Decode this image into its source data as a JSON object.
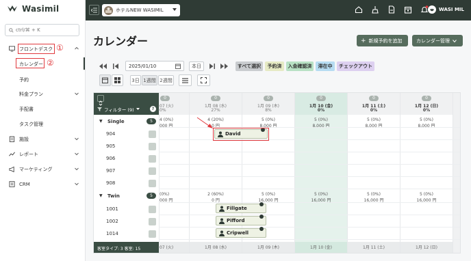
{
  "app": {
    "name": "Wasimil"
  },
  "search": {
    "placeholder": "ctrl/⌘ + K"
  },
  "sidebar": {
    "items": [
      {
        "label": "フロントデスク",
        "icon": "monitor-icon"
      },
      {
        "label": "カレンダー"
      },
      {
        "label": "予約"
      },
      {
        "label": "料金プラン"
      },
      {
        "label": "手配書"
      },
      {
        "label": "タスク管理"
      },
      {
        "label": "施設",
        "icon": "building-icon"
      },
      {
        "label": "レポート",
        "icon": "report-icon"
      },
      {
        "label": "マーケティング",
        "icon": "megaphone-icon"
      },
      {
        "label": "CRM",
        "icon": "crm-icon"
      }
    ],
    "annotations": {
      "one": "①",
      "two": "②"
    }
  },
  "topbar": {
    "hotel": "ホテルNEW WASIMIL",
    "user": "WASI MIL",
    "icons": [
      "home-icon",
      "cleaning-icon",
      "document-icon",
      "calendar-icon",
      "bell-icon"
    ]
  },
  "page": {
    "title": "カレンダー",
    "add_button": "新規予約を追加",
    "manage_button": "カレンダー管理"
  },
  "toolbar": {
    "date": "2025/01/10",
    "today": "本日",
    "select_all": "すべて選択",
    "status": [
      "予約済",
      "入金確認済",
      "滞在中",
      "チェックアウト"
    ],
    "spans": [
      "3日",
      "1週間",
      "2週間"
    ],
    "status_colors": [
      "#e6eac4",
      "#b8e1c4",
      "#b6dcf2",
      "#ddd0f0"
    ]
  },
  "calendar": {
    "filter_label": "フィルター (9)",
    "days": [
      {
        "label": "1月 07 (火)",
        "count": "0",
        "pct": "0%",
        "today": false
      },
      {
        "label": "1月 08 (水)",
        "count": "0",
        "pct": "27%",
        "today": false
      },
      {
        "label": "1月 09 (木)",
        "count": "0",
        "pct": "8%",
        "today": false
      },
      {
        "label": "1月 10 (金)",
        "count": "0",
        "pct": "0%",
        "today": true
      },
      {
        "label": "1月 11 (土)",
        "count": "0",
        "pct": "0%",
        "today": false
      },
      {
        "label": "1月 12 (日)",
        "count": "0",
        "pct": "0%",
        "today": false
      }
    ],
    "room_types": [
      {
        "name": "Single",
        "count": "5",
        "rooms": [
          "904",
          "905",
          "906",
          "907",
          "908"
        ],
        "avail": [
          [
            "4 (0%)",
            "000 円"
          ],
          [
            "4 (20%)",
            "0 円"
          ],
          [
            "5 (0%)",
            "8,000 円"
          ],
          [
            "5 (0%)",
            "8,000 円"
          ],
          [
            "5 (0%)",
            "8,000 円"
          ],
          [
            "5 (0%)",
            "8,000 円"
          ]
        ]
      },
      {
        "name": "Twin",
        "count": "5",
        "rooms": [
          "1001",
          "1002",
          "1014"
        ],
        "avail": [
          [
            "(0%)",
            "000 円"
          ],
          [
            "2 (60%)",
            "0 円"
          ],
          [
            "5 (0%)",
            "16,000 円"
          ],
          [
            "5 (0%)",
            "16,000 円"
          ],
          [
            "5 (0%)",
            "16,000 円"
          ],
          [
            "5 (0%)",
            "16,000 円"
          ]
        ]
      }
    ],
    "reservations": [
      {
        "name": "David"
      },
      {
        "name": "Fillgate"
      },
      {
        "name": "Pifford"
      },
      {
        "name": "Cripwell"
      }
    ],
    "footer_left": "客室タイプ: 3 客室: 15",
    "footer_days": [
      "07 (火)",
      "1月 08 (水)",
      "1月 09 (木)",
      "1月 10 (金)",
      "1月 11 (土)",
      "1月 12 (日)"
    ]
  }
}
